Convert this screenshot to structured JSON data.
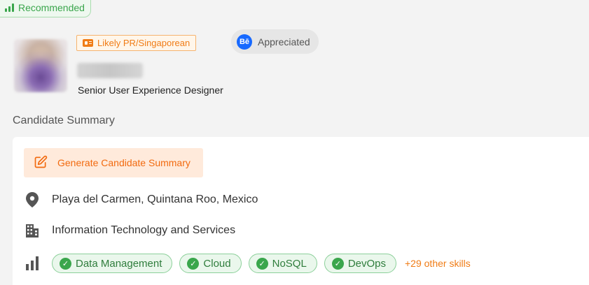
{
  "recommended": {
    "label": "Recommended",
    "icon": "signal-bars-icon"
  },
  "candidate": {
    "pr_badge": "Likely PR/Singaporean",
    "appreciated": {
      "label": "Appreciated",
      "icon_text": "Bē"
    },
    "job_title": "Senior User Experience Designer"
  },
  "summary": {
    "section_title": "Candidate Summary",
    "generate_button": "Generate Candidate Summary",
    "location": "Playa del Carmen, Quintana Roo, Mexico",
    "industry": "Information Technology and Services",
    "skills": [
      "Data Management",
      "Cloud",
      "NoSQL",
      "DevOps"
    ],
    "more_skills": "+29 other skills"
  },
  "colors": {
    "accent_orange": "#f07c16",
    "success_green": "#3aa64c",
    "behance_blue": "#1769ff"
  }
}
